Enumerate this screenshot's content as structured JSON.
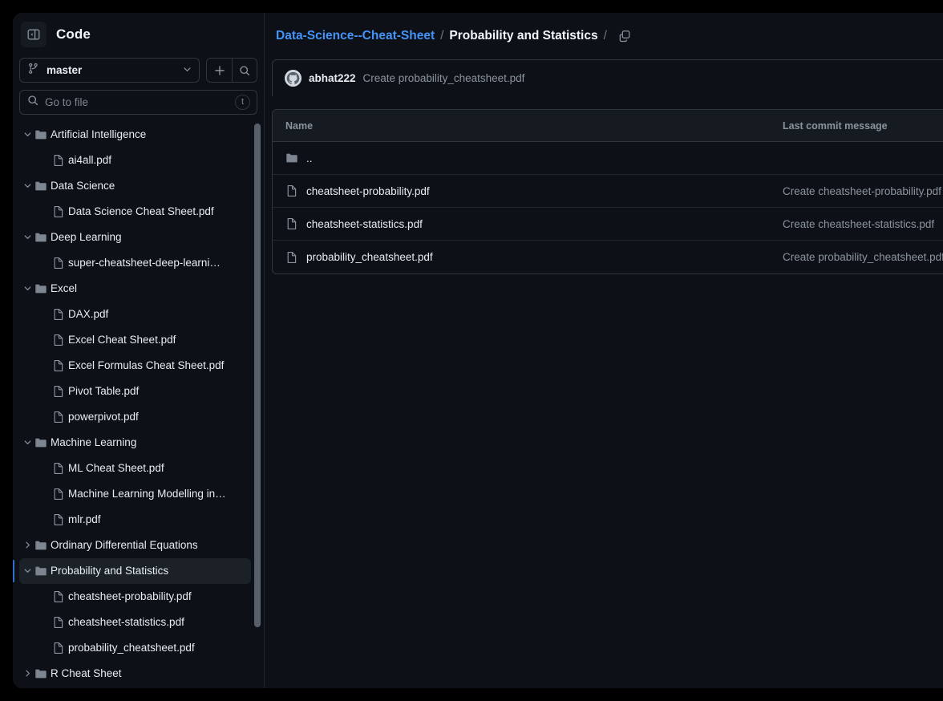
{
  "sidebar": {
    "panel_title": "Code",
    "collapse_icon": "sidebar-collapse-icon",
    "branch": {
      "icon": "git-branch-icon",
      "name": "master",
      "chevron": "chevron-down-icon"
    },
    "add_button_icon": "plus-icon",
    "search_button_icon": "search-icon",
    "gotofile": {
      "icon": "search-icon",
      "placeholder": "Go to file",
      "shortcut": "t"
    },
    "tree": [
      {
        "label": "Artificial Intelligence",
        "type": "dir",
        "depth": 0,
        "expanded": true,
        "selected": false
      },
      {
        "label": "ai4all.pdf",
        "type": "file",
        "depth": 1,
        "expanded": null,
        "selected": false
      },
      {
        "label": "Data Science",
        "type": "dir",
        "depth": 0,
        "expanded": true,
        "selected": false
      },
      {
        "label": "Data Science Cheat Sheet.pdf",
        "type": "file",
        "depth": 1,
        "expanded": null,
        "selected": false
      },
      {
        "label": "Deep Learning",
        "type": "dir",
        "depth": 0,
        "expanded": true,
        "selected": false
      },
      {
        "label": "super-cheatsheet-deep-learni…",
        "type": "file",
        "depth": 1,
        "expanded": null,
        "selected": false
      },
      {
        "label": "Excel",
        "type": "dir",
        "depth": 0,
        "expanded": true,
        "selected": false
      },
      {
        "label": "DAX.pdf",
        "type": "file",
        "depth": 1,
        "expanded": null,
        "selected": false
      },
      {
        "label": "Excel Cheat Sheet.pdf",
        "type": "file",
        "depth": 1,
        "expanded": null,
        "selected": false
      },
      {
        "label": "Excel Formulas Cheat Sheet.pdf",
        "type": "file",
        "depth": 1,
        "expanded": null,
        "selected": false
      },
      {
        "label": "Pivot Table.pdf",
        "type": "file",
        "depth": 1,
        "expanded": null,
        "selected": false
      },
      {
        "label": "powerpivot.pdf",
        "type": "file",
        "depth": 1,
        "expanded": null,
        "selected": false
      },
      {
        "label": "Machine Learning",
        "type": "dir",
        "depth": 0,
        "expanded": true,
        "selected": false
      },
      {
        "label": "ML Cheat Sheet.pdf",
        "type": "file",
        "depth": 1,
        "expanded": null,
        "selected": false
      },
      {
        "label": "Machine Learning Modelling in…",
        "type": "file",
        "depth": 1,
        "expanded": null,
        "selected": false
      },
      {
        "label": "mlr.pdf",
        "type": "file",
        "depth": 1,
        "expanded": null,
        "selected": false
      },
      {
        "label": "Ordinary Differential Equations",
        "type": "dir",
        "depth": 0,
        "expanded": false,
        "selected": false
      },
      {
        "label": "Probability and Statistics",
        "type": "dir",
        "depth": 0,
        "expanded": true,
        "selected": true
      },
      {
        "label": "cheatsheet-probability.pdf",
        "type": "file",
        "depth": 1,
        "expanded": null,
        "selected": false
      },
      {
        "label": "cheatsheet-statistics.pdf",
        "type": "file",
        "depth": 1,
        "expanded": null,
        "selected": false
      },
      {
        "label": "probability_cheatsheet.pdf",
        "type": "file",
        "depth": 1,
        "expanded": null,
        "selected": false
      },
      {
        "label": "R Cheat Sheet",
        "type": "dir",
        "depth": 0,
        "expanded": false,
        "selected": false
      }
    ]
  },
  "main": {
    "breadcrumb": {
      "repo": "Data-Science--Cheat-Sheet",
      "separator": "/",
      "current": "Probability and Statistics",
      "trailing_separator": "/",
      "copy_icon": "copy-path-icon"
    },
    "latest_commit": {
      "avatar_icon": "github-avatar-icon",
      "author": "abhat222",
      "message": "Create probability_cheatsheet.pdf"
    },
    "table": {
      "columns": {
        "name": "Name",
        "last_commit_message": "Last commit message"
      },
      "rows": [
        {
          "icon": "folder-icon",
          "name": "..",
          "type": "dir",
          "message": ""
        },
        {
          "icon": "file-icon",
          "name": "cheatsheet-probability.pdf",
          "type": "file",
          "message": "Create cheatsheet-probability.pdf"
        },
        {
          "icon": "file-icon",
          "name": "cheatsheet-statistics.pdf",
          "type": "file",
          "message": "Create cheatsheet-statistics.pdf"
        },
        {
          "icon": "file-icon",
          "name": "probability_cheatsheet.pdf",
          "type": "file",
          "message": "Create probability_cheatsheet.pdf"
        }
      ]
    }
  },
  "colors": {
    "accent_link": "#4493f8",
    "selection_bar": "#316dca",
    "background": "#0d1117",
    "border": "#30363d",
    "muted_text": "#8b949e"
  }
}
